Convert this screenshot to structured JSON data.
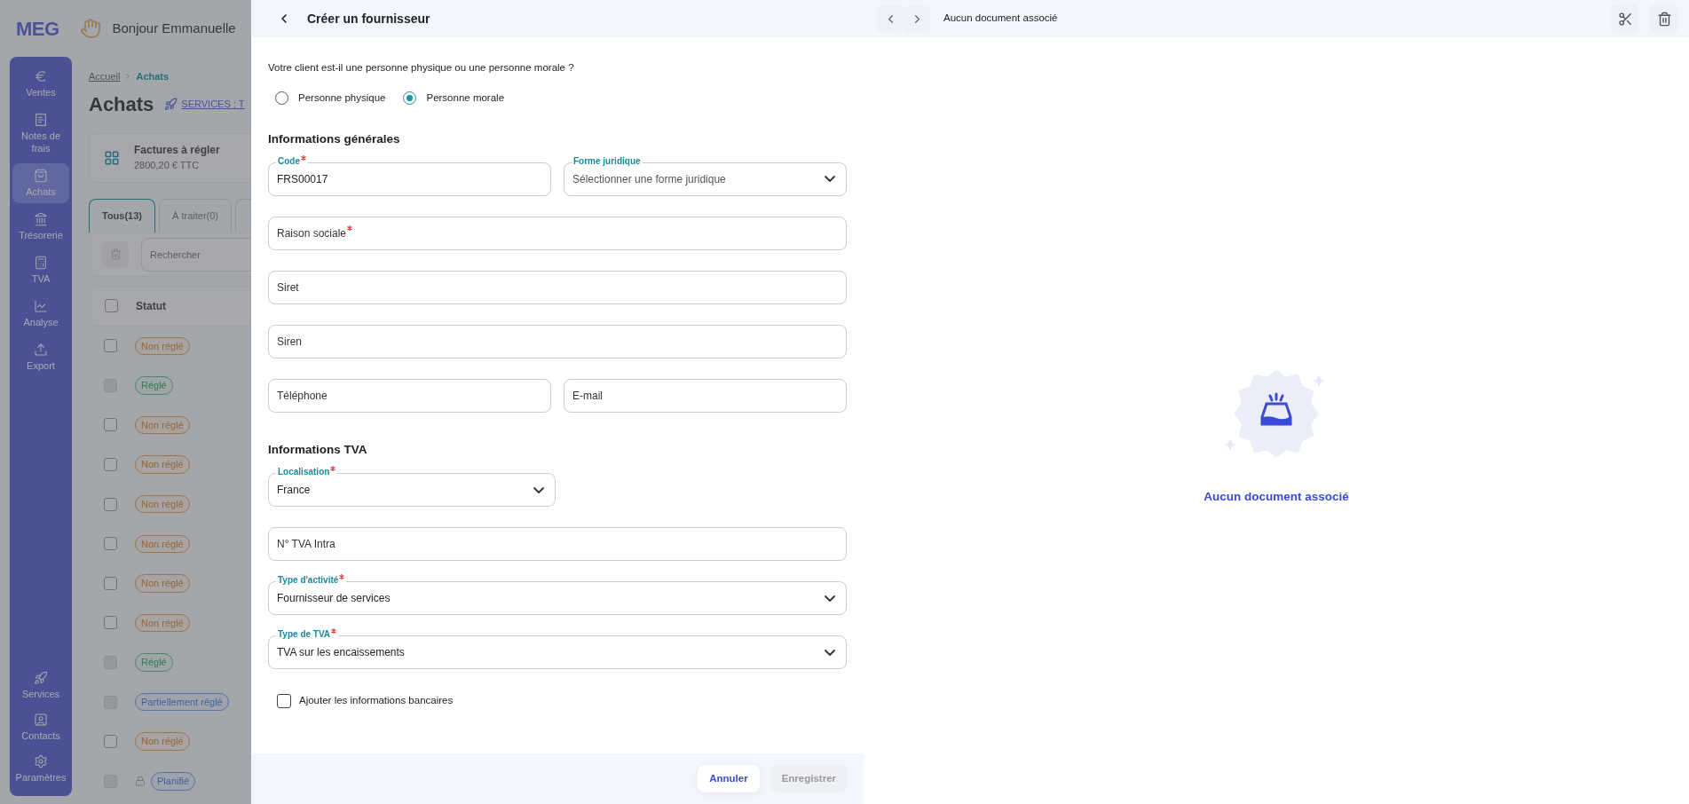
{
  "app": {
    "logo": "MEG",
    "greeting": "Bonjour Emmanuelle",
    "nav": [
      {
        "label": "Ventes",
        "selected": false
      },
      {
        "label": "Notes de frais",
        "selected": false
      },
      {
        "label": "Achats",
        "selected": true
      },
      {
        "label": "Trésorerie",
        "selected": false
      },
      {
        "label": "TVA",
        "selected": false
      },
      {
        "label": "Analyse",
        "selected": false
      },
      {
        "label": "Export",
        "selected": false
      }
    ],
    "nav_bottom": [
      {
        "label": "Services",
        "selected": false
      },
      {
        "label": "Contacts",
        "selected": false
      },
      {
        "label": "Paramètres",
        "selected": false
      }
    ],
    "breadcrumb": [
      {
        "label": "Accueil",
        "current": false
      },
      {
        "label": "Achats",
        "current": true
      }
    ],
    "page_title": "Achats",
    "services_link": "SERVICES : T",
    "summary": {
      "title": "Factures à régler",
      "amount": "2800,20 € TTC"
    },
    "tabs": [
      {
        "label": "Tous(13)",
        "selected": true
      },
      {
        "label": "À traiter(0)",
        "selected": false
      },
      {
        "selected": false
      }
    ],
    "search": {
      "placeholder": "Rechercher"
    },
    "table": {
      "columns": [
        "Statut"
      ],
      "select_all_checked": false,
      "rows": [
        {
          "status": "Non réglé",
          "kind": "unpaid",
          "disabled": false,
          "locked": false
        },
        {
          "status": "Réglé",
          "kind": "paid",
          "disabled": true,
          "locked": false
        },
        {
          "status": "Non réglé",
          "kind": "unpaid",
          "disabled": false,
          "locked": false
        },
        {
          "status": "Non réglé",
          "kind": "unpaid",
          "disabled": false,
          "locked": false
        },
        {
          "status": "Non réglé",
          "kind": "unpaid",
          "disabled": false,
          "locked": false
        },
        {
          "status": "Non réglé",
          "kind": "unpaid",
          "disabled": false,
          "locked": false
        },
        {
          "status": "Non réglé",
          "kind": "unpaid",
          "disabled": false,
          "locked": false
        },
        {
          "status": "Non réglé",
          "kind": "unpaid",
          "disabled": false,
          "locked": false
        },
        {
          "status": "Réglé",
          "kind": "paid",
          "disabled": true,
          "locked": false
        },
        {
          "status": "Partiellement réglé",
          "kind": "partial",
          "disabled": true,
          "locked": false
        },
        {
          "status": "Non réglé",
          "kind": "unpaid",
          "disabled": false,
          "locked": false
        },
        {
          "status": "Planifié",
          "kind": "planned",
          "disabled": true,
          "locked": true
        }
      ]
    }
  },
  "form": {
    "title": "Créer un fournisseur",
    "question": "Votre client est-il une personne physique ou une personne morale ?",
    "person_types": [
      {
        "label": "Personne physique",
        "selected": false
      },
      {
        "label": "Personne morale",
        "selected": true
      }
    ],
    "sections": [
      {
        "title": "Informations générales",
        "rows": [
          [
            {
              "kind": "text",
              "label": "Code",
              "required": true,
              "value": "FRS00017"
            },
            {
              "kind": "select",
              "label": "Forme juridique",
              "required": false,
              "placeholder": "Sélectionner une forme juridique"
            }
          ],
          [
            {
              "kind": "text",
              "label": "Raison sociale",
              "required": true
            }
          ],
          [
            {
              "kind": "text",
              "label": "Siret",
              "required": false
            }
          ],
          [
            {
              "kind": "text",
              "label": "Siren",
              "required": false
            }
          ],
          [
            {
              "kind": "text",
              "label": "Téléphone",
              "required": false
            },
            {
              "kind": "text",
              "label": "E-mail",
              "required": false
            }
          ]
        ]
      },
      {
        "title": "Informations TVA",
        "rows": [
          [
            {
              "kind": "short_select",
              "label": "Localisation",
              "required": true,
              "value": "France"
            }
          ],
          [
            {
              "kind": "text",
              "label": "N° TVA Intra",
              "required": false
            }
          ],
          [
            {
              "kind": "select",
              "label": "Type d'activité",
              "required": true,
              "value": "Fournisseur de services"
            }
          ],
          [
            {
              "kind": "select",
              "label": "Type de TVA",
              "required": true,
              "value": "TVA sur les encaissements"
            }
          ]
        ]
      }
    ],
    "bank_info": {
      "label": "Ajouter les informations bancaires",
      "checked": false
    },
    "buttons": [
      {
        "label": "Annuler",
        "disabled": false
      },
      {
        "label": "Enregistrer",
        "disabled": true
      }
    ]
  },
  "viewer": {
    "title": "Aucun document associé",
    "empty_text": "Aucun document associé"
  }
}
